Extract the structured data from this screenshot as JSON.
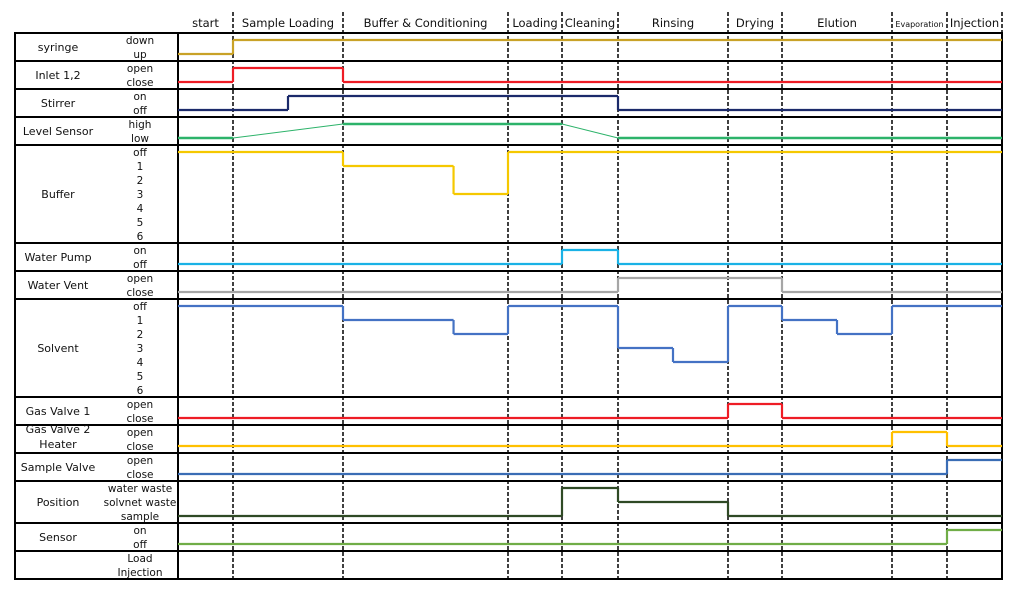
{
  "phases": [
    "start",
    "Sample Loading",
    "Buffer & Conditioning",
    "Loading",
    "Cleaning",
    "Rinsing",
    "Drying",
    "Elution",
    "Evaporation",
    "Injection"
  ],
  "rows": [
    {
      "label": [
        "syringe"
      ],
      "states": [
        "down",
        "up"
      ],
      "signal": {
        "color": "#c9a227",
        "steps": [
          [
            0,
            "up"
          ],
          [
            1,
            "down"
          ],
          [
            10,
            "down"
          ]
        ]
      }
    },
    {
      "label": [
        "Inlet 1,2"
      ],
      "states": [
        "open",
        "close"
      ],
      "signal": {
        "color": "#ee1c25",
        "steps": [
          [
            0,
            "close"
          ],
          [
            1,
            "open"
          ],
          [
            2,
            "close"
          ],
          [
            10,
            "close"
          ]
        ]
      }
    },
    {
      "label": [
        "Stirrer"
      ],
      "states": [
        "on",
        "off"
      ],
      "signal": {
        "color": "#1b2a6b",
        "steps": [
          [
            0,
            "off"
          ],
          [
            1.5,
            "on"
          ],
          [
            5,
            "off"
          ],
          [
            10,
            "off"
          ]
        ]
      }
    },
    {
      "label": [
        "Level Sensor"
      ],
      "states": [
        "high",
        "low"
      ],
      "signal": {
        "color": "#2db36a",
        "ramp": true,
        "points": [
          [
            0,
            "low"
          ],
          [
            1,
            "low"
          ],
          [
            2,
            "high"
          ],
          [
            4,
            "high"
          ],
          [
            5,
            "low"
          ],
          [
            10,
            "low"
          ]
        ]
      }
    },
    {
      "label": [
        "Buffer"
      ],
      "states": [
        "off",
        "1",
        "2",
        "3",
        "4",
        "5",
        "6"
      ],
      "signal": {
        "color": "#f5c800",
        "steps": [
          [
            0,
            "off"
          ],
          [
            2,
            "1"
          ],
          [
            2.67,
            "3"
          ],
          [
            3,
            "off"
          ],
          [
            10,
            "off"
          ]
        ]
      }
    },
    {
      "label": [
        "Water Pump"
      ],
      "states": [
        "on",
        "off"
      ],
      "signal": {
        "color": "#1ab2e6",
        "steps": [
          [
            0,
            "off"
          ],
          [
            4,
            "on"
          ],
          [
            5,
            "off"
          ],
          [
            10,
            "off"
          ]
        ]
      }
    },
    {
      "label": [
        "Water Vent"
      ],
      "states": [
        "open",
        "close"
      ],
      "signal": {
        "color": "#a6a6a6",
        "steps": [
          [
            0,
            "close"
          ],
          [
            5,
            "open"
          ],
          [
            7,
            "close"
          ],
          [
            10,
            "close"
          ]
        ]
      }
    },
    {
      "label": [
        "Solvent"
      ],
      "states": [
        "off",
        "1",
        "2",
        "3",
        "4",
        "5",
        "6"
      ],
      "signal": {
        "color": "#4472c4",
        "steps": [
          [
            0,
            "off"
          ],
          [
            2,
            "1"
          ],
          [
            2.67,
            "2"
          ],
          [
            3,
            "off"
          ],
          [
            5,
            "3"
          ],
          [
            5.5,
            "4"
          ],
          [
            6,
            "off"
          ],
          [
            7,
            "1"
          ],
          [
            7.5,
            "2"
          ],
          [
            8,
            "off"
          ],
          [
            10,
            "off"
          ]
        ]
      }
    },
    {
      "label": [
        "Gas Valve 1"
      ],
      "states": [
        "open",
        "close"
      ],
      "signal": {
        "color": "#ee1c25",
        "steps": [
          [
            0,
            "close"
          ],
          [
            6,
            "open"
          ],
          [
            7,
            "close"
          ],
          [
            10,
            "close"
          ]
        ]
      }
    },
    {
      "label": [
        "Gas Valve 2",
        "Heater"
      ],
      "states": [
        "open",
        "close"
      ],
      "signal": {
        "color": "#ffc000",
        "steps": [
          [
            0,
            "close"
          ],
          [
            8,
            "open"
          ],
          [
            9,
            "close"
          ],
          [
            10,
            "close"
          ]
        ]
      }
    },
    {
      "label": [
        "Sample Valve"
      ],
      "states": [
        "open",
        "close"
      ],
      "signal": {
        "color": "#3a6db5",
        "steps": [
          [
            0,
            "close"
          ],
          [
            9,
            "open"
          ],
          [
            10,
            "open"
          ]
        ]
      }
    },
    {
      "label": [
        "Position"
      ],
      "states": [
        "water waste",
        "solvnet waste",
        "sample"
      ],
      "signal": {
        "color": "#2f4a25",
        "steps": [
          [
            0,
            "sample"
          ],
          [
            4,
            "water waste"
          ],
          [
            5,
            "solvnet waste"
          ],
          [
            6,
            "sample"
          ],
          [
            10,
            "sample"
          ]
        ]
      }
    },
    {
      "label": [
        "Sensor"
      ],
      "states": [
        "on",
        "off"
      ],
      "signal": {
        "color": "#70ad47",
        "steps": [
          [
            0,
            "off"
          ],
          [
            9,
            "on"
          ],
          [
            10,
            "on"
          ]
        ]
      }
    },
    {
      "label": [
        ""
      ],
      "states": [
        "Load",
        "Injection"
      ]
    }
  ]
}
